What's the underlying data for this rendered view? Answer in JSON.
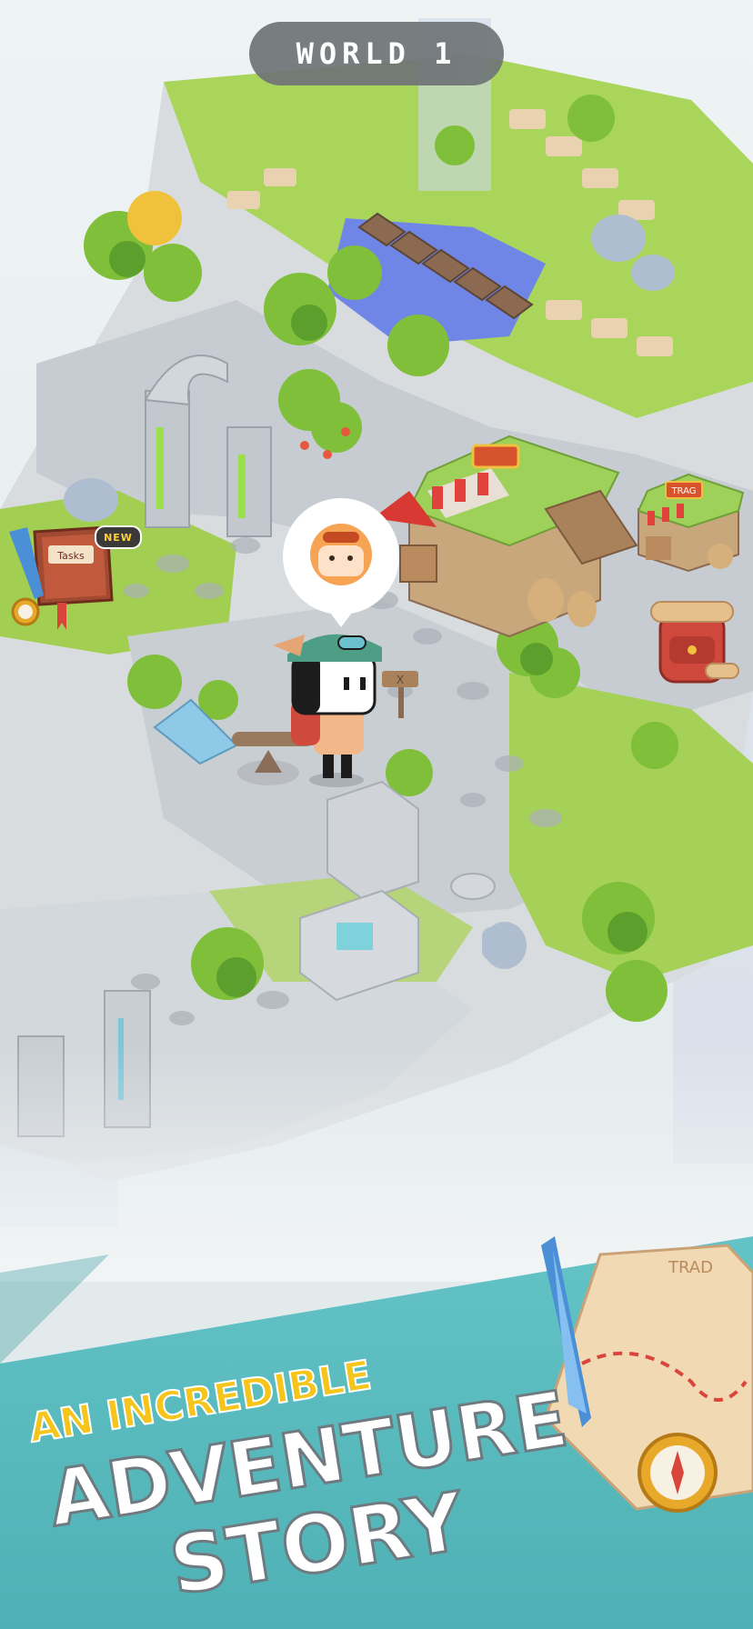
{
  "header": {
    "world_label": "WORLD 1"
  },
  "side_buttons": {
    "tasks_badge": "NEW",
    "tasks_book_label": "Tasks",
    "shop_sign": "TRAG"
  },
  "map": {
    "shop_sign": "TRAG",
    "sign_mark": "X"
  },
  "promo": {
    "line1": "AN INCREDIBLE",
    "line2": "ADVENTURE",
    "line3": "STORY",
    "scroll_text": "TRAD"
  },
  "colors": {
    "sky": "#e6eef0",
    "grass": "#9dcf4a",
    "stone": "#c9ced3",
    "banner_teal": "#5ab9bd",
    "title_yellow": "#f6c51c"
  }
}
